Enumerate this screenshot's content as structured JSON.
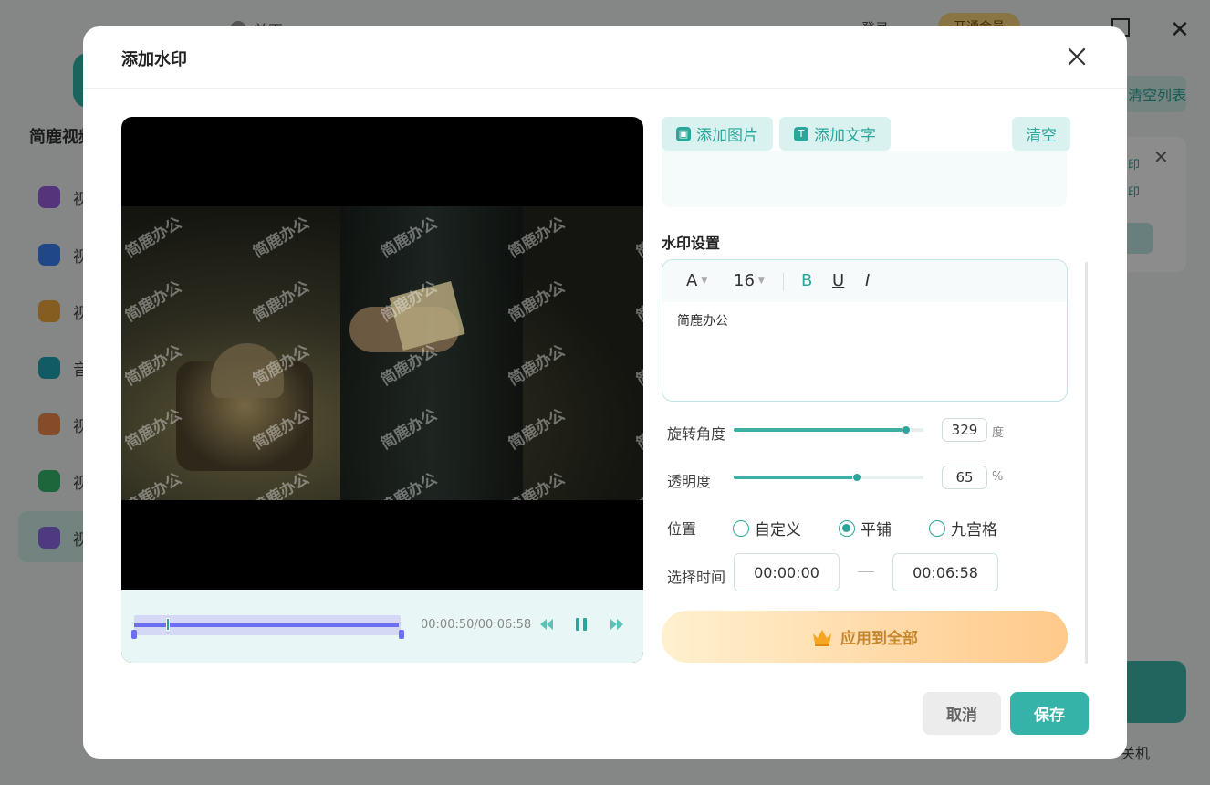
{
  "background": {
    "home_label": "首页",
    "login_label": "登录",
    "vip_label": "开通会员",
    "brand": "简鹿视频",
    "clear_list_label": "清空列表",
    "sidebar_items": [
      "视",
      "视",
      "视",
      "音",
      "视",
      "视",
      "视"
    ],
    "card_line1": "印",
    "card_line2": "印",
    "shutdown_label": "关机"
  },
  "dialog": {
    "title": "添加水印",
    "add_image_label": "添加图片",
    "add_text_label": "添加文字",
    "clear_label": "清空",
    "section_title": "水印设置",
    "editor": {
      "font_label": "A",
      "font_size": "16",
      "bold_label": "B",
      "underline_label": "U",
      "italic_label": "I",
      "content": "简鹿办公"
    },
    "rotation": {
      "label": "旋转角度",
      "value": "329",
      "unit": "度",
      "fraction": 0.91
    },
    "opacity": {
      "label": "透明度",
      "value": "65",
      "unit": "%",
      "fraction": 0.65
    },
    "position": {
      "label": "位置",
      "options": [
        "自定义",
        "平铺",
        "九宫格"
      ],
      "selected": "平铺"
    },
    "time_select": {
      "label": "选择时间",
      "start": "00:00:00",
      "end": "00:06:58"
    },
    "apply_all_label": "应用到全部",
    "cancel_label": "取消",
    "save_label": "保存"
  },
  "player": {
    "time_display": "00:00:50/00:06:58",
    "watermark_text": "简鹿办公",
    "progress_fraction": 0.12
  },
  "colors": {
    "accent": "#2aa69a",
    "track": "#6b6ef0",
    "apply_gradient_start": "#fff0cf",
    "apply_gradient_end": "#ffc98a"
  }
}
